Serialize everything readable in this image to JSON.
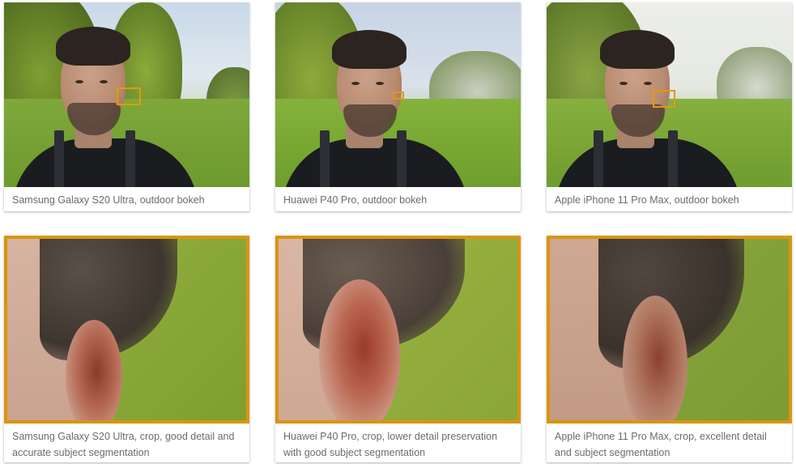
{
  "accent_color": "#d9950d",
  "marker_color": "#e09a12",
  "cards": [
    {
      "caption": "Samsung Galaxy S20 Ultra, outdoor bokeh"
    },
    {
      "caption": "Huawei P40 Pro, outdoor bokeh"
    },
    {
      "caption": "Apple iPhone 11 Pro Max, outdoor bokeh"
    },
    {
      "caption": "Samsung Galaxy S20 Ultra, crop, good detail and accurate subject segmentation"
    },
    {
      "caption": "Huawei P40 Pro, crop, lower detail preservation with good subject segmentation"
    },
    {
      "caption": "Apple iPhone 11 Pro Max, crop, excellent detail and subject segmentation"
    }
  ]
}
